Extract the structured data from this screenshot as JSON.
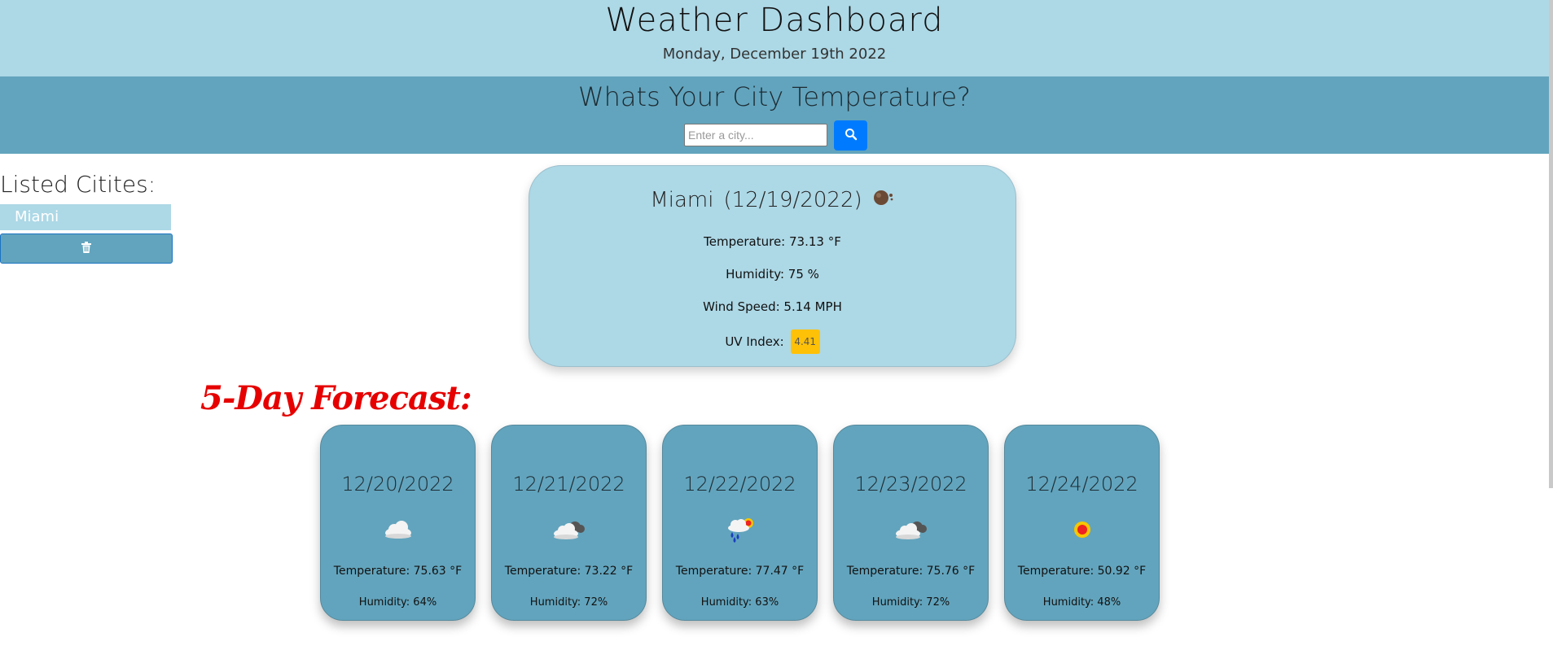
{
  "header": {
    "title": "Weather Dashboard",
    "date": "Monday, December 19th 2022"
  },
  "search": {
    "heading": "Whats Your City Temperature?",
    "placeholder": "Enter a city...",
    "button_icon": "search-icon"
  },
  "sidebar": {
    "title": "Listed Citites:",
    "cities": [
      "Miami"
    ],
    "clear_icon": "trash-icon"
  },
  "current": {
    "city": "Miami",
    "date": "(12/19/2022)",
    "icon": "broken-clouds-icon",
    "temperature": "Temperature: 73.13 °F",
    "humidity": "Humidity: 75 %",
    "wind": "Wind Speed: 5.14 MPH",
    "uv_label": "UV Index:",
    "uv_value": "4.41",
    "uv_color": "#ffc107"
  },
  "forecast": {
    "title": "5-Day Forecast:",
    "days": [
      {
        "date": "12/20/2022",
        "icon": "cloud-icon",
        "temperature": "Temperature: 75.63 °F",
        "humidity": "Humidity: 64%"
      },
      {
        "date": "12/21/2022",
        "icon": "overcast-clouds-icon",
        "temperature": "Temperature: 73.22 °F",
        "humidity": "Humidity: 72%"
      },
      {
        "date": "12/22/2022",
        "icon": "rain-sun-icon",
        "temperature": "Temperature: 77.47 °F",
        "humidity": "Humidity: 63%"
      },
      {
        "date": "12/23/2022",
        "icon": "overcast-clouds-icon",
        "temperature": "Temperature: 75.76 °F",
        "humidity": "Humidity: 72%"
      },
      {
        "date": "12/24/2022",
        "icon": "sun-icon",
        "temperature": "Temperature: 50.92 °F",
        "humidity": "Humidity: 48%"
      }
    ]
  },
  "colors": {
    "header_bg": "#add8e6",
    "band_bg": "#62a4bd",
    "forecast_title": "#e60000",
    "search_button": "#007bff"
  }
}
